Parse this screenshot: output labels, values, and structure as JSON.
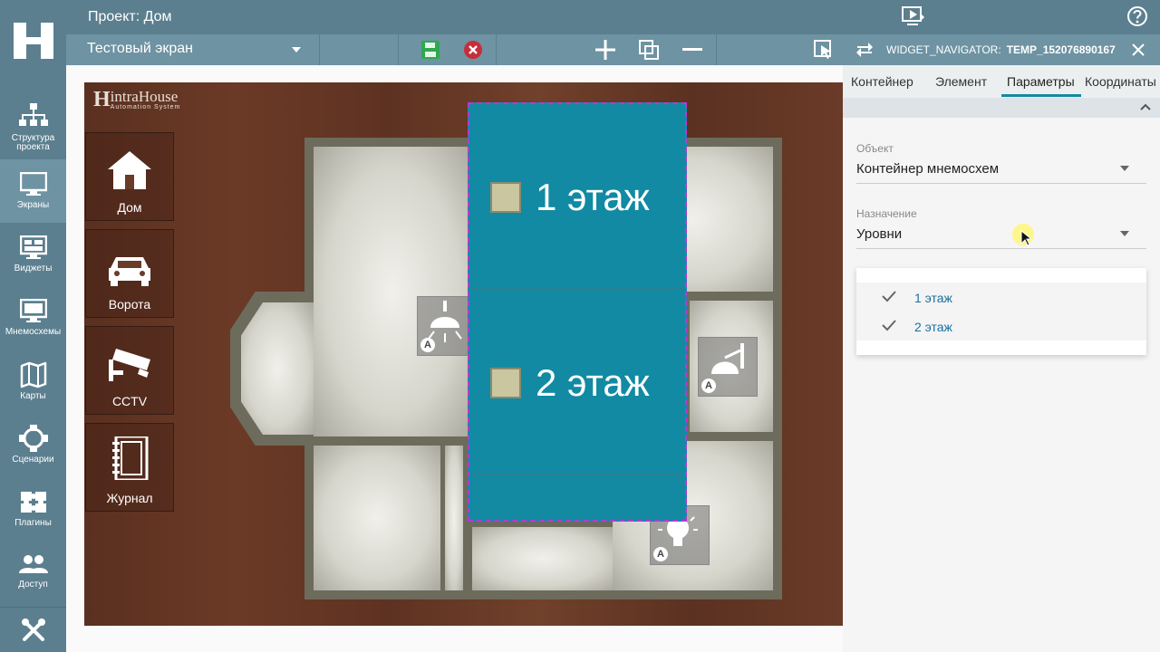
{
  "app": {
    "project_title": "Проект: Дом"
  },
  "sidebar": {
    "items": [
      {
        "label": "Структура проекта",
        "icon": "structure-icon"
      },
      {
        "label": "Экраны",
        "icon": "screen-icon"
      },
      {
        "label": "Виджеты",
        "icon": "widgets-icon"
      },
      {
        "label": "Мнемосхемы",
        "icon": "mnemo-icon"
      },
      {
        "label": "Карты",
        "icon": "map-icon"
      },
      {
        "label": "Сценарии",
        "icon": "scenario-icon"
      },
      {
        "label": "Плагины",
        "icon": "puzzle-icon"
      },
      {
        "label": "Доступ",
        "icon": "users-icon"
      }
    ],
    "active_index": 1
  },
  "toolbar": {
    "screen_name": "Тестовый экран"
  },
  "stage": {
    "logo_letter": "H",
    "logo_name": "intraHouse",
    "logo_sub": "Automation System",
    "tiles": [
      {
        "label": "Дом",
        "icon": "house-icon"
      },
      {
        "label": "Ворота",
        "icon": "car-icon"
      },
      {
        "label": "CCTV",
        "icon": "camera-icon"
      },
      {
        "label": "Журнал",
        "icon": "journal-icon"
      }
    ],
    "levels": [
      "1 этаж",
      "2 этаж"
    ],
    "auto_badge": "A"
  },
  "panel": {
    "title_prefix": "WIDGET_NAVIGATOR:",
    "title_id": "TEMP_152076890167",
    "tabs": [
      "Контейнер",
      "Элемент",
      "Параметры",
      "Координаты"
    ],
    "active_tab": "Параметры",
    "object_label": "Объект",
    "object_value": "Контейнер мнемосхем",
    "purpose_label": "Назначение",
    "purpose_value": "Уровни",
    "options": [
      "1 этаж",
      "2 этаж"
    ]
  },
  "colors": {
    "chrome": "#5b7f8f",
    "chrome_light": "#6e93a3",
    "accent": "#138aa2",
    "selection": "#b43ad6"
  }
}
